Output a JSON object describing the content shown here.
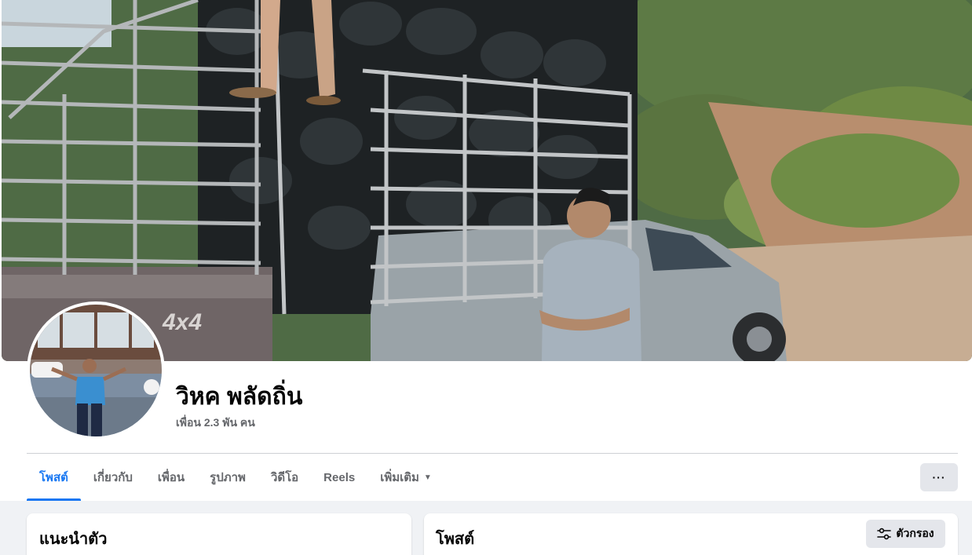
{
  "profile": {
    "name": "วิหค พลัดถิ่น",
    "friends": "เพื่อน 2.3 พัน คน"
  },
  "tabs": [
    {
      "label": "โพสต์",
      "active": true
    },
    {
      "label": "เกี่ยวกับ"
    },
    {
      "label": "เพื่อน"
    },
    {
      "label": "รูปภาพ"
    },
    {
      "label": "วิดีโอ"
    },
    {
      "label": "Reels"
    },
    {
      "label": "เพิ่มเติม",
      "icon": "caret-down-icon"
    }
  ],
  "more_button": {
    "label": "···",
    "icon": "ellipsis-icon"
  },
  "intro_card": {
    "title": "แนะนำตัว"
  },
  "posts_card": {
    "title": "โพสต์",
    "filter_label": "ตัวกรอง",
    "filter_icon": "sliders-icon"
  },
  "colors": {
    "accent": "#1877f2",
    "page_bg": "#f0f2f5",
    "secondary_text": "#65676b",
    "button_bg": "#e4e6eb"
  }
}
